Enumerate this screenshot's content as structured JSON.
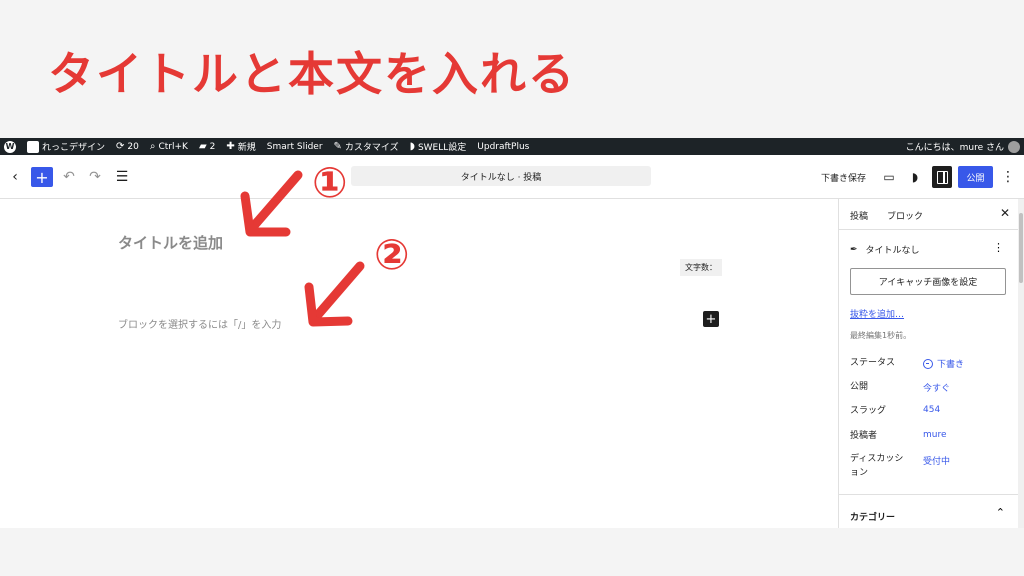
{
  "heading": "タイトルと本文を入れる",
  "admin_bar": {
    "site_name": "れっこデザイン",
    "updates_count": "20",
    "search_shortcut": "Ctrl+K",
    "comments_count": "2",
    "new_label": "新規",
    "smart_slider": "Smart Slider",
    "customize": "カスタマイズ",
    "swell_settings": "SWELL設定",
    "updraftplus": "UpdraftPlus",
    "greeting": "こんにちは、mure さん"
  },
  "toolbar": {
    "document_title": "タイトルなし · 投稿",
    "save_draft": "下書き保存",
    "publish": "公開"
  },
  "editor": {
    "title_placeholder": "タイトルを追加",
    "word_count": "文字数：",
    "block_placeholder": "ブロックを選択するには「/」を入力"
  },
  "sidebar": {
    "tab_post": "投稿",
    "tab_block": "ブロック",
    "post_name": "タイトルなし",
    "featured_image_button": "アイキャッチ画像を設定",
    "excerpt_link": "抜粋を追加…",
    "last_edited": "最終編集1秒前。",
    "meta": [
      {
        "label": "ステータス",
        "value": "下書き"
      },
      {
        "label": "公開",
        "value": "今すぐ"
      },
      {
        "label": "スラッグ",
        "value": "454"
      },
      {
        "label": "投稿者",
        "value": "mure"
      },
      {
        "label": "ディスカッション",
        "value": "受付中"
      }
    ],
    "categories_label": "カテゴリー"
  },
  "callouts": {
    "one": "①",
    "two": "②"
  },
  "colors": {
    "accent": "#e53935",
    "wp_blue": "#3858e9",
    "admin_bar": "#1d2327"
  }
}
